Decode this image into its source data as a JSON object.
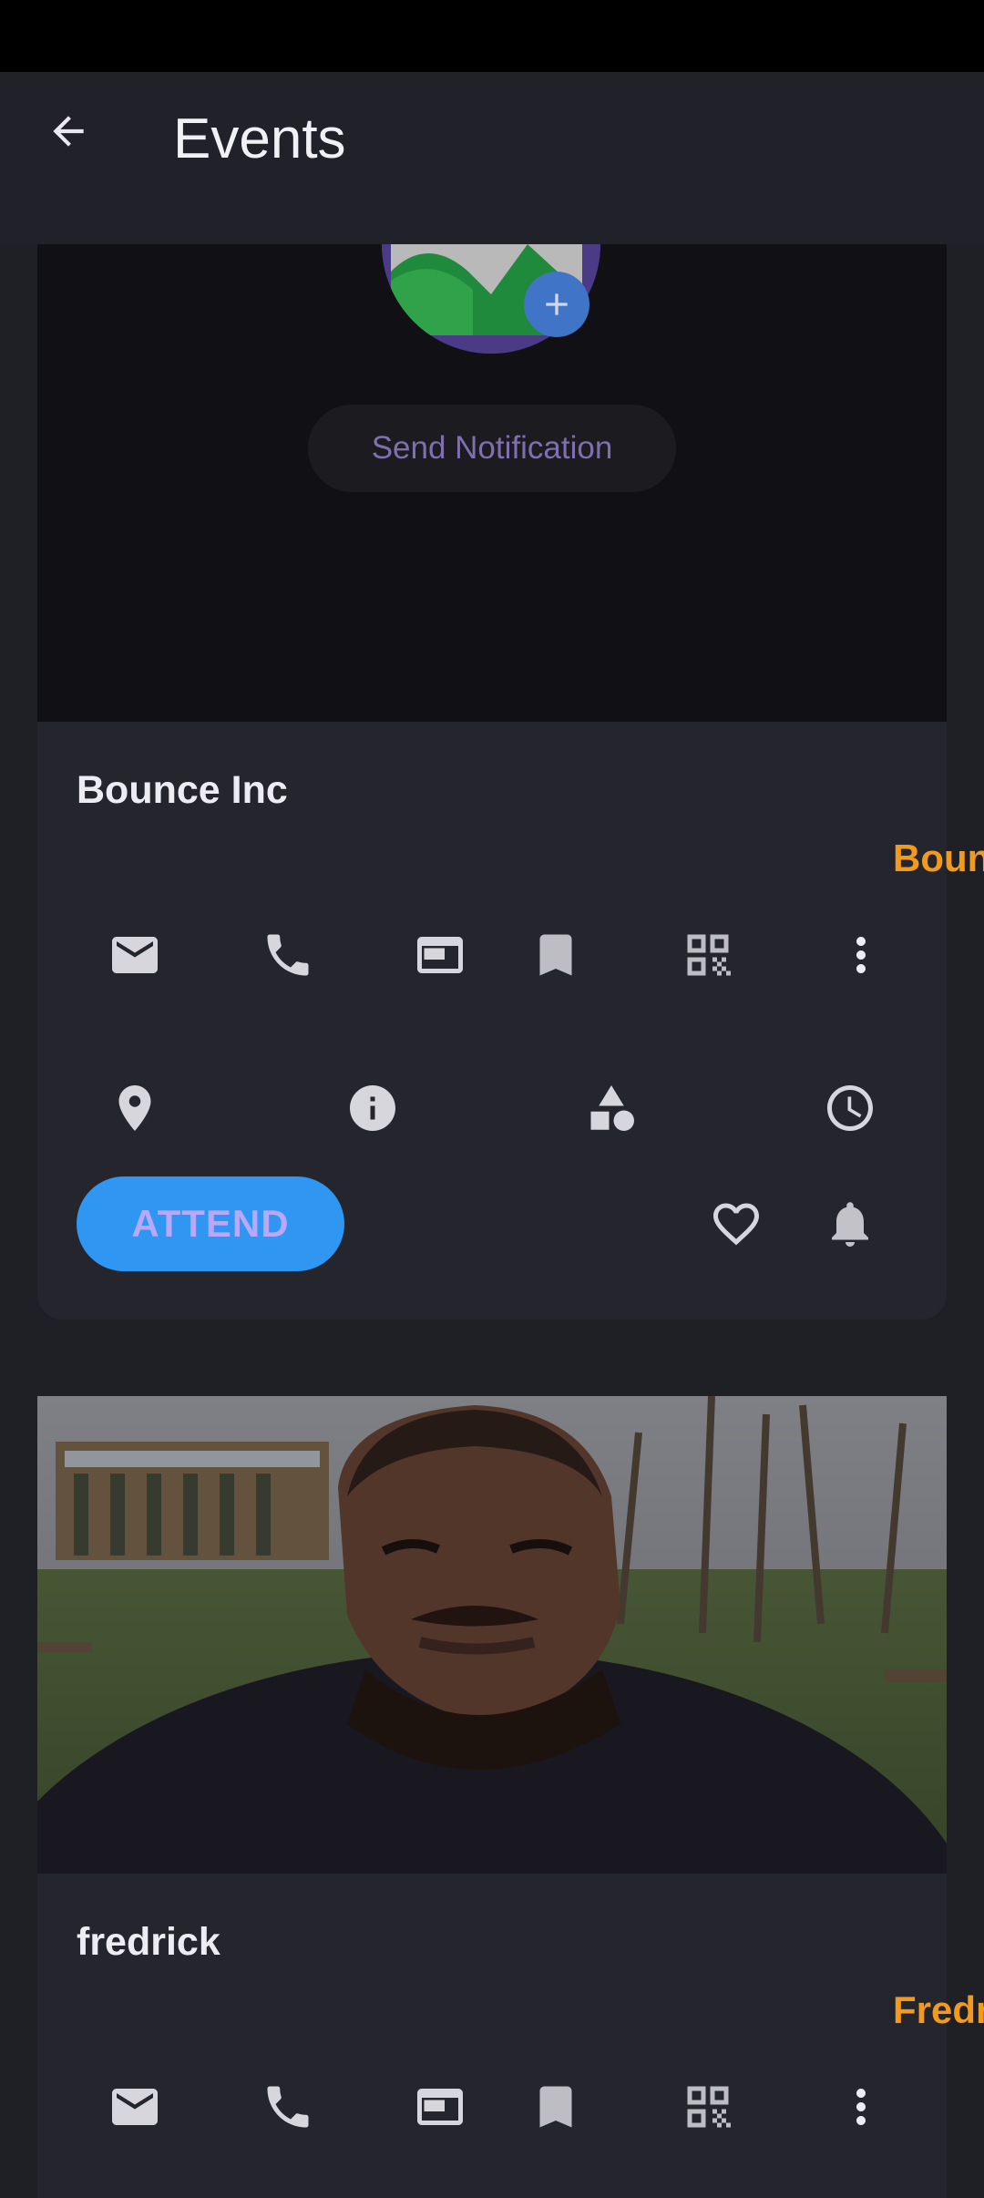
{
  "app_bar": {
    "title": "Events"
  },
  "events": [
    {
      "notify_label": "Send Notification",
      "name": "Bounce Inc",
      "edge_label": "Boun",
      "attend_label": "ATTEND"
    },
    {
      "name": "fredrick",
      "edge_label": "Fredr"
    }
  ],
  "colors": {
    "accent_blue": "#2f96f2",
    "edge_label_orange": "#f29a1e",
    "background": "#1f1f26",
    "card": "#25252d"
  },
  "icons": [
    "arrow-left-icon",
    "email-icon",
    "phone-icon",
    "card-icon",
    "bookmark-icon",
    "qr-code-icon",
    "more-vert-icon",
    "location-pin-icon",
    "info-icon",
    "shapes-icon",
    "clock-icon",
    "heart-outline-icon",
    "bell-icon",
    "plus-icon"
  ]
}
